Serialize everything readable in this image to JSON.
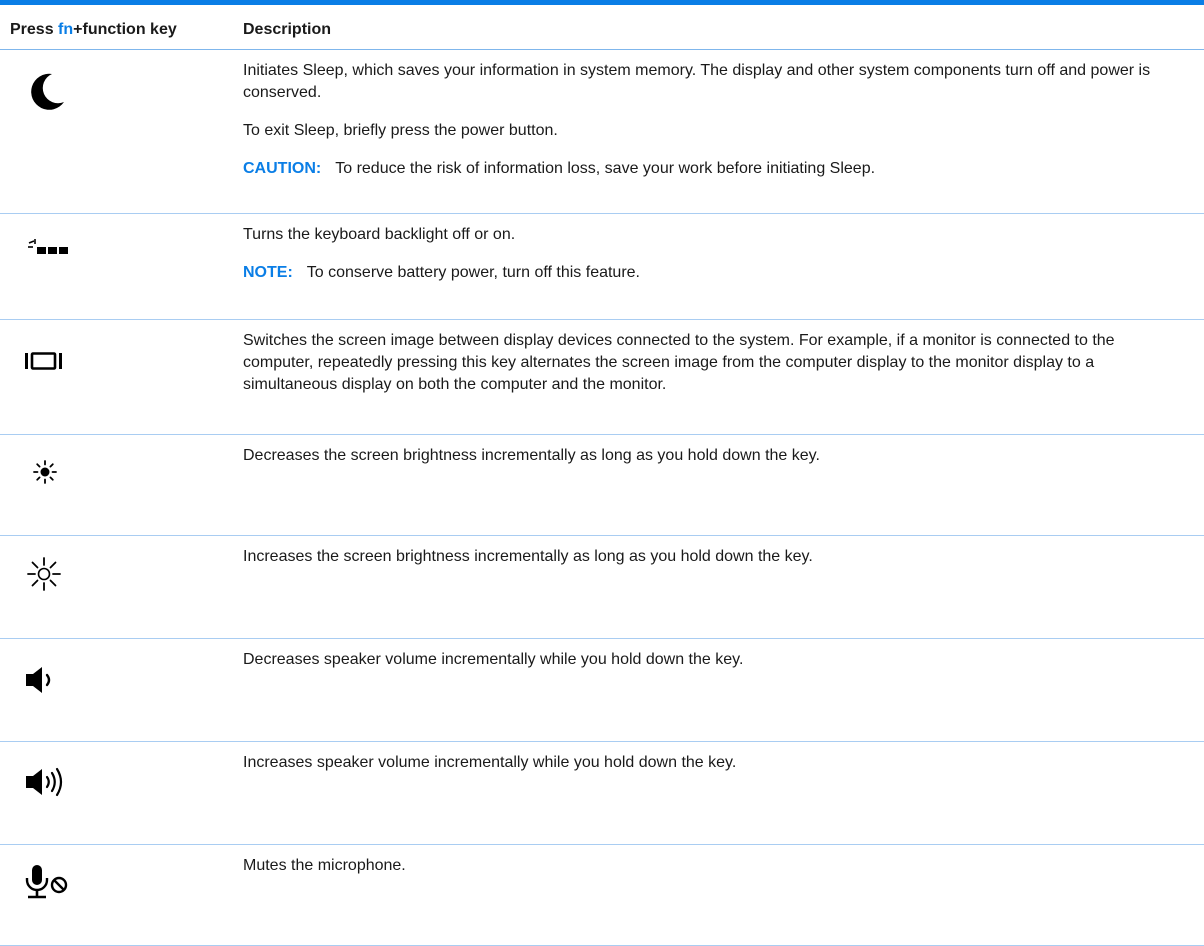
{
  "header": {
    "col1_prefix": "Press ",
    "col1_fn": "fn",
    "col1_suffix": "+function key",
    "col2": "Description"
  },
  "colors": {
    "accent": "#0a7ee6",
    "text": "#1a1a1a",
    "rule": "#a9cdf2"
  },
  "rows": [
    {
      "icon": "sleep-moon-icon",
      "paragraphs": [
        "Initiates Sleep, which saves your information in system memory. The display and other system components turn off and power is conserved.",
        "To exit Sleep, briefly press the power button."
      ],
      "note_label": "CAUTION:",
      "note_text": "To reduce the risk of information loss, save your work before initiating Sleep."
    },
    {
      "icon": "keyboard-backlight-icon",
      "paragraphs": [
        "Turns the keyboard backlight off or on."
      ],
      "note_label": "NOTE:",
      "note_text": "To conserve battery power, turn off this feature."
    },
    {
      "icon": "display-switch-icon",
      "paragraphs": [
        "Switches the screen image between display devices connected to the system. For example, if a monitor is connected to the computer, repeatedly pressing this key alternates the screen image from the computer display to the monitor display to a simultaneous display on both the computer and the monitor."
      ]
    },
    {
      "icon": "brightness-down-icon",
      "paragraphs": [
        "Decreases the screen brightness incrementally as long as you hold down the key."
      ]
    },
    {
      "icon": "brightness-up-icon",
      "paragraphs": [
        "Increases the screen brightness incrementally as long as you hold down the key."
      ]
    },
    {
      "icon": "volume-down-icon",
      "paragraphs": [
        "Decreases speaker volume incrementally while you hold down the key."
      ]
    },
    {
      "icon": "volume-up-icon",
      "paragraphs": [
        "Increases speaker volume incrementally while you hold down the key."
      ]
    },
    {
      "icon": "mic-mute-icon",
      "paragraphs": [
        "Mutes the microphone."
      ]
    }
  ]
}
